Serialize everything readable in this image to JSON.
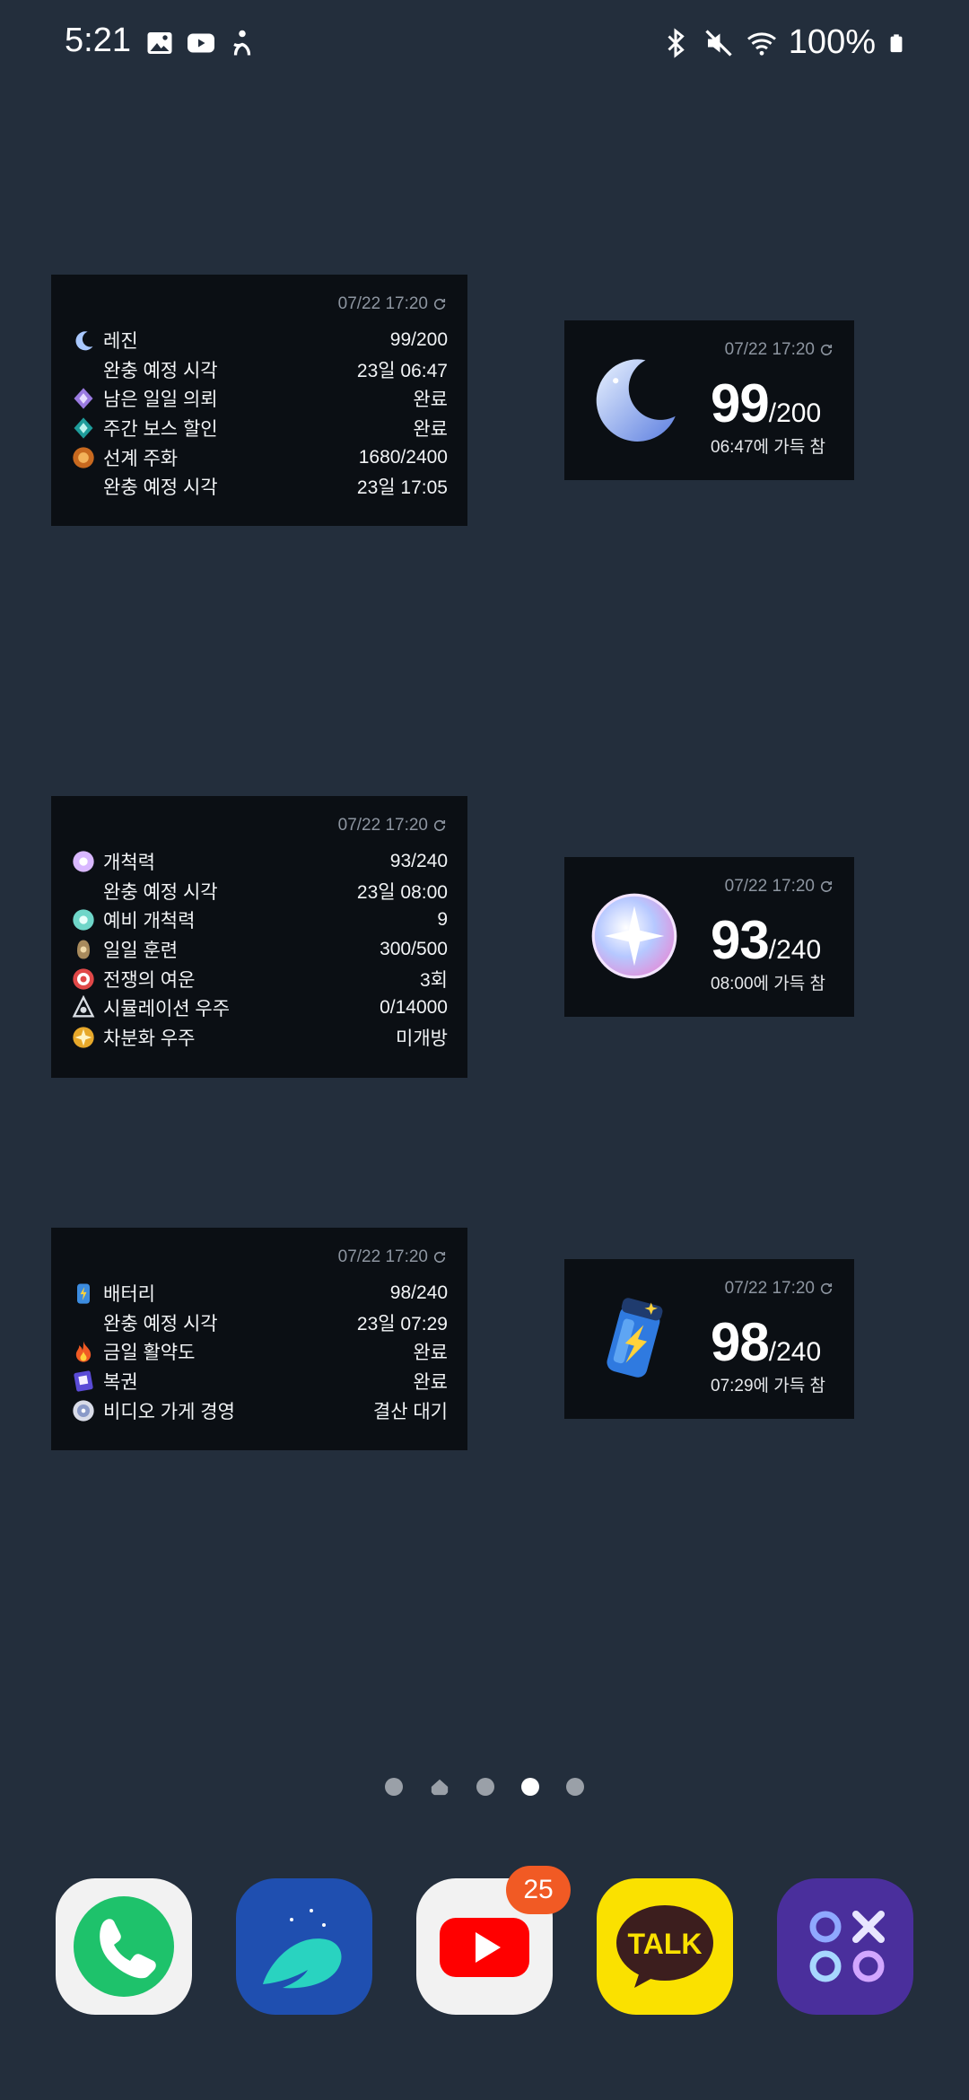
{
  "status_bar": {
    "time": "5:21",
    "left_icons": [
      "gallery-icon",
      "youtube-icon",
      "accessibility-icon"
    ],
    "right_icons": [
      "bluetooth-icon",
      "mute-icon",
      "wifi-icon",
      "battery-icon"
    ],
    "battery": "100%"
  },
  "widgets": {
    "genshin_list": {
      "timestamp": "07/22 17:20",
      "rows": [
        {
          "label": "레진",
          "value": "99/200",
          "icon": "moon-icon"
        },
        {
          "label": "완충 예정 시각",
          "value": "23일 06:47"
        },
        {
          "label": "남은 일일 의뢰",
          "value": "완료",
          "icon": "commission-icon"
        },
        {
          "label": "주간 보스 할인",
          "value": "완료",
          "icon": "boss-icon"
        },
        {
          "label": "선계 주화",
          "value": "1680/2400",
          "icon": "realm-currency-icon"
        },
        {
          "label": "완충 예정 시각",
          "value": "23일 17:05"
        }
      ]
    },
    "genshin_big": {
      "timestamp": "07/22 17:20",
      "current": "99",
      "max": "/200",
      "subtitle": "06:47에 가득 참",
      "icon": "resin-moon-icon"
    },
    "starrail_list": {
      "timestamp": "07/22 17:20",
      "rows": [
        {
          "label": "개척력",
          "value": "93/240",
          "icon": "trailblaze-icon"
        },
        {
          "label": "완충 예정 시각",
          "value": "23일 08:00"
        },
        {
          "label": "예비 개척력",
          "value": "9",
          "icon": "reserve-icon"
        },
        {
          "label": "일일 훈련",
          "value": "300/500",
          "icon": "training-icon"
        },
        {
          "label": "전쟁의 여운",
          "value": "3회",
          "icon": "echo-of-war-icon"
        },
        {
          "label": "시뮬레이션 우주",
          "value": "0/14000",
          "icon": "simulated-universe-icon"
        },
        {
          "label": "차분화 우주",
          "value": "미개방",
          "icon": "divergent-universe-icon"
        }
      ]
    },
    "starrail_big": {
      "timestamp": "07/22 17:20",
      "current": "93",
      "max": "/240",
      "subtitle": "08:00에 가득 참",
      "icon": "trailblaze-power-icon"
    },
    "zzz_list": {
      "timestamp": "07/22 17:20",
      "rows": [
        {
          "label": "배터리",
          "value": "98/240",
          "icon": "battery-charge-icon"
        },
        {
          "label": "완충 예정 시각",
          "value": "23일 07:29"
        },
        {
          "label": "금일 활약도",
          "value": "완료",
          "icon": "fire-icon"
        },
        {
          "label": "복권",
          "value": "완료",
          "icon": "lottery-icon"
        },
        {
          "label": "비디오 가게 경영",
          "value": "결산 대기",
          "icon": "video-store-icon"
        }
      ]
    },
    "zzz_big": {
      "timestamp": "07/22 17:20",
      "current": "98",
      "max": "/240",
      "subtitle": "07:29에 가득 참",
      "icon": "battery-big-icon"
    }
  },
  "page_indicator": {
    "count": 5,
    "home_index": 1,
    "active_index": 3
  },
  "dock": {
    "apps": [
      {
        "name": "phone",
        "color": "#1ec26b"
      },
      {
        "name": "whale-browser",
        "color": "#1f5fc4"
      },
      {
        "name": "youtube",
        "color": "#ff0000",
        "badge": "25"
      },
      {
        "name": "kakaotalk",
        "color": "#fae100",
        "label": "TALK"
      },
      {
        "name": "games",
        "color": "#5b3aa8"
      }
    ]
  }
}
